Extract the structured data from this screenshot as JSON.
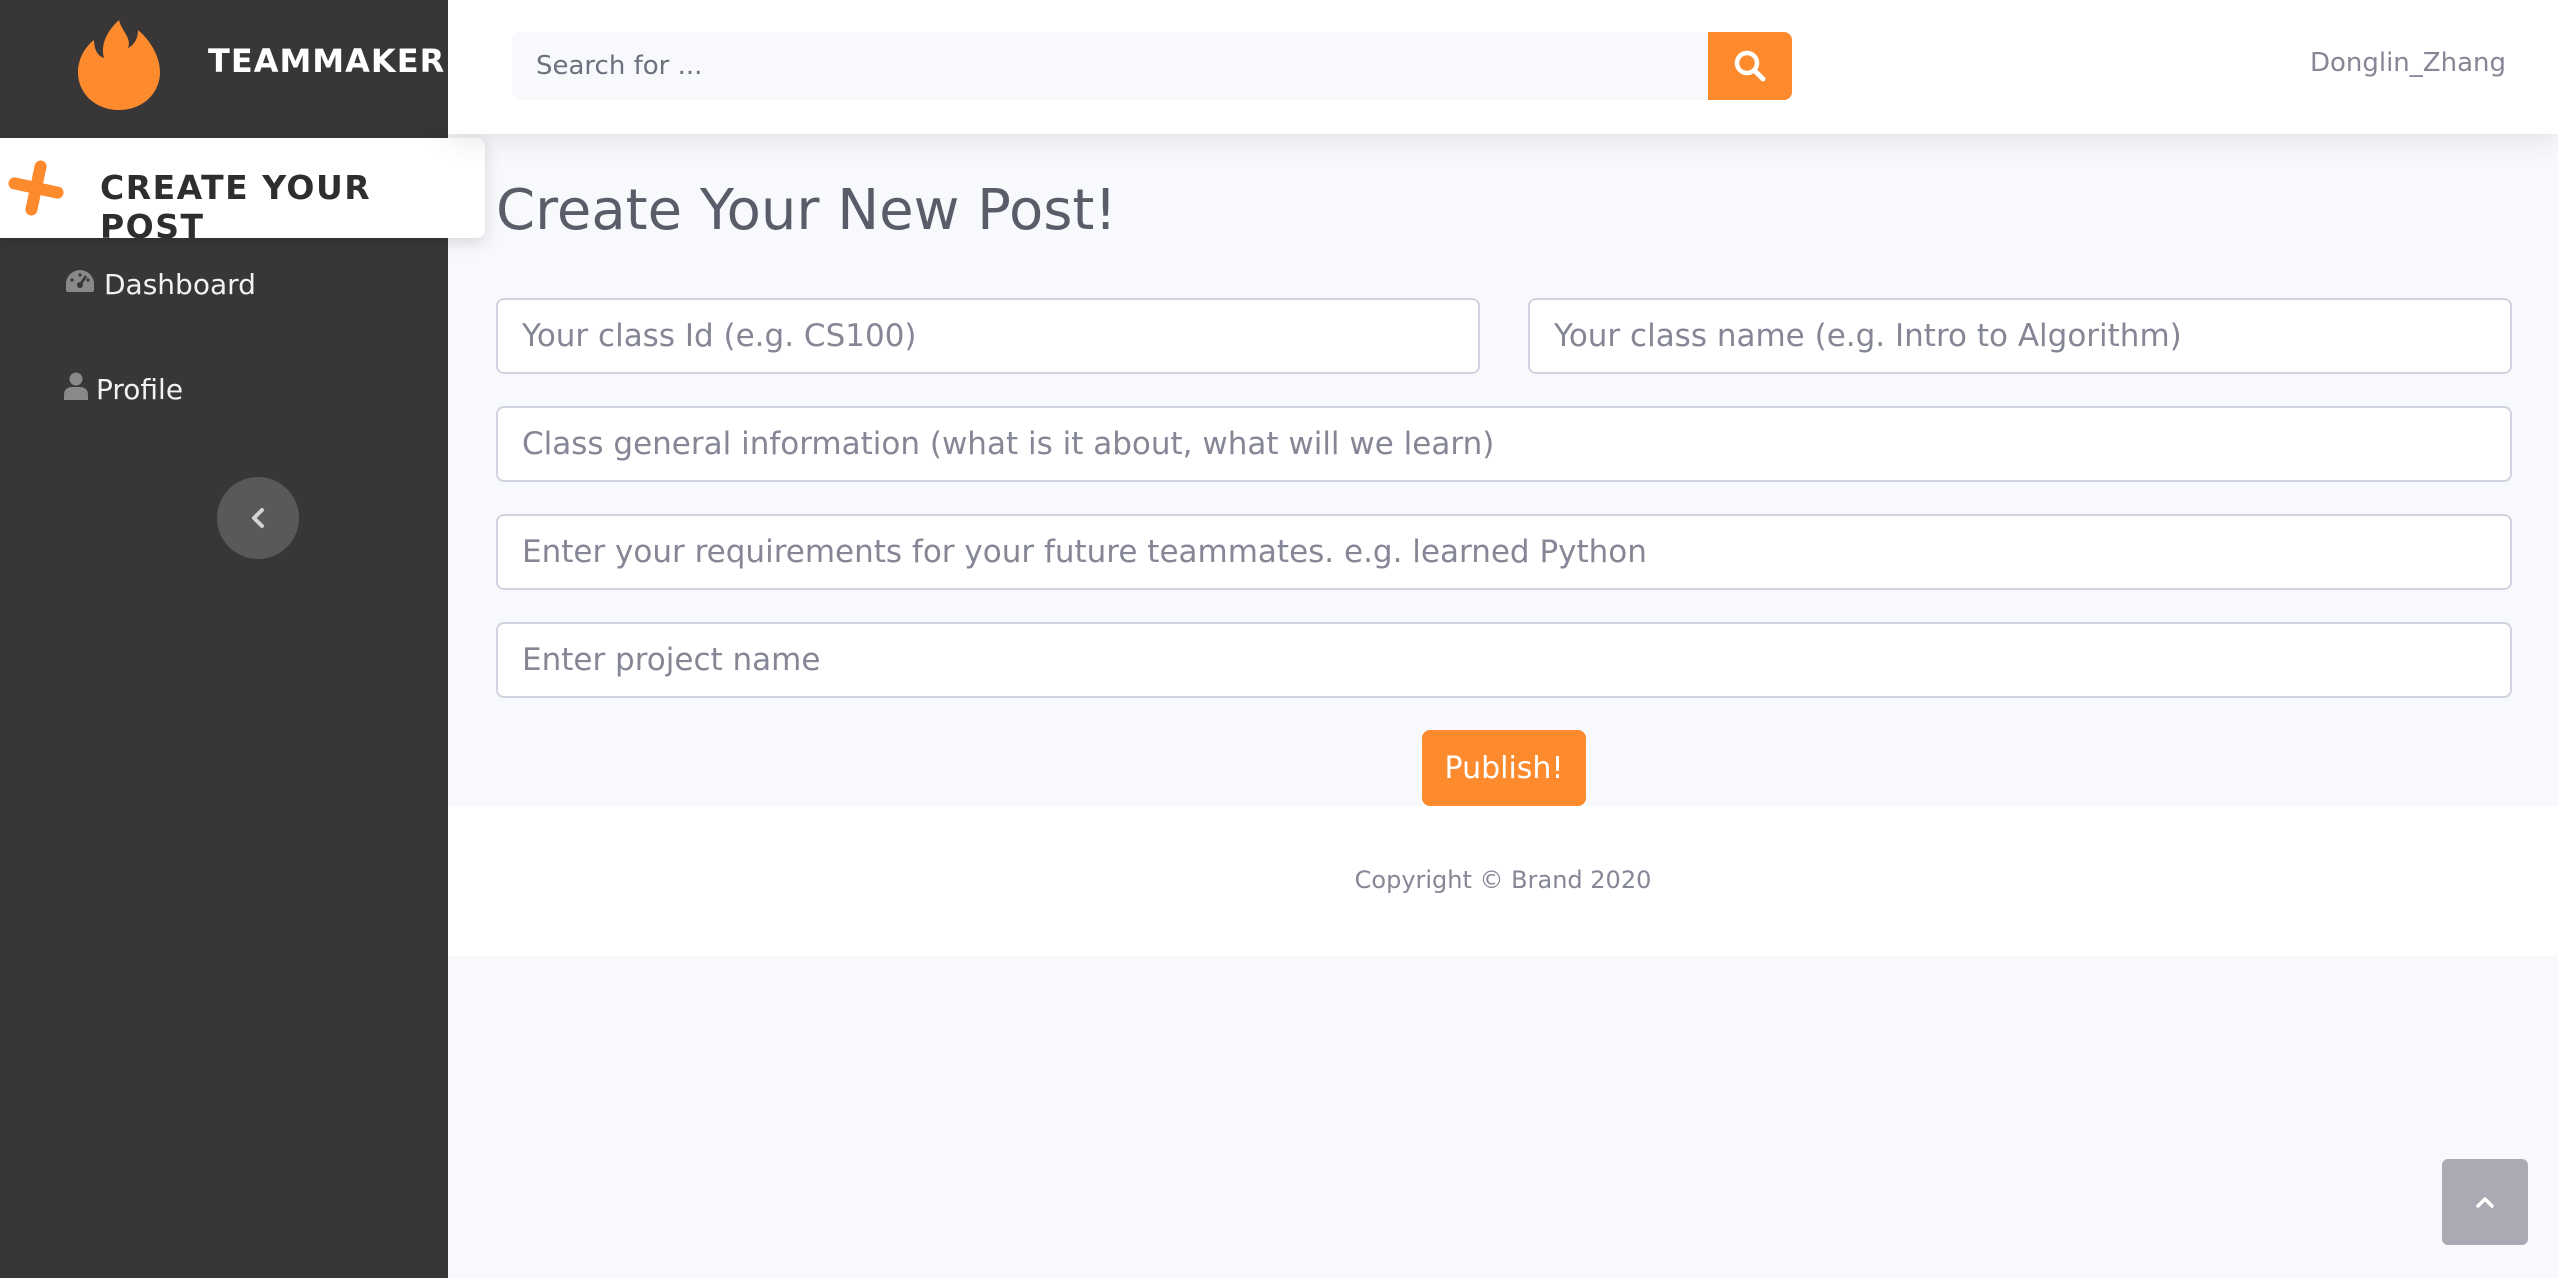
{
  "colors": {
    "accent": "#fd8b2e",
    "sidebar_bg": "#383637",
    "page_bg": "#f8f9fc",
    "text_muted": "#858796"
  },
  "sidebar": {
    "brand": {
      "logo_icon": "flame-icon",
      "name": "TEAMMAKER"
    },
    "create_post": {
      "icon": "plus-icon",
      "label": "CREATE YOUR POST"
    },
    "items": [
      {
        "icon": "tachometer-icon",
        "label": "Dashboard"
      },
      {
        "icon": "user-icon",
        "label": "Profile"
      }
    ],
    "collapse_icon": "chevron-left-icon"
  },
  "topbar": {
    "search": {
      "placeholder": "Search for ...",
      "value": "",
      "button_icon": "search-icon"
    },
    "username": "Donglin_Zhang"
  },
  "main": {
    "title": "Create Your New Post!",
    "form": {
      "class_id_placeholder": "Your class Id (e.g. CS100)",
      "class_name_placeholder": "Your class name (e.g. Intro to Algorithm)",
      "info_placeholder": "Class general information (what is it about, what will we learn)",
      "requirements_placeholder": "Enter your requirements for your future teammates. e.g. learned Python",
      "project_placeholder": "Enter project name",
      "publish_label": "Publish!"
    }
  },
  "footer": {
    "copyright": "Copyright © Brand 2020"
  },
  "scroll_top_icon": "chevron-up-icon"
}
